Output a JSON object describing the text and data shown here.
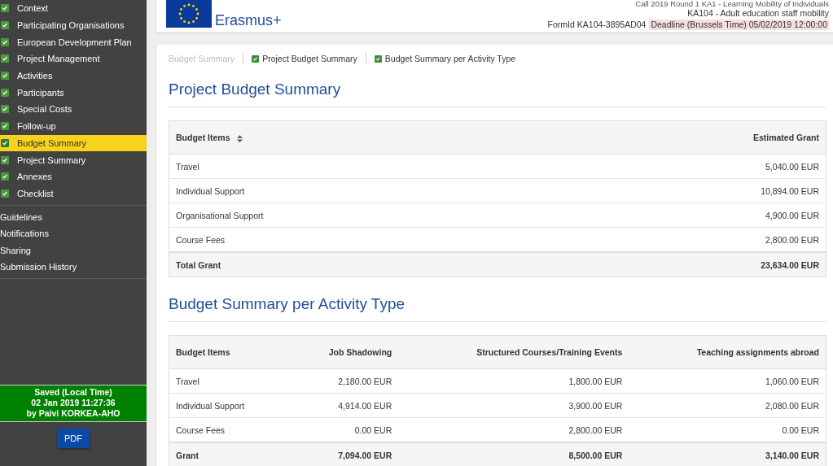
{
  "sidebar": {
    "items": [
      {
        "label": "Context",
        "checked": true,
        "selected": false
      },
      {
        "label": "Participating Organisations",
        "checked": true,
        "selected": false
      },
      {
        "label": "European Development Plan",
        "checked": true,
        "selected": false
      },
      {
        "label": "Project Management",
        "checked": true,
        "selected": false
      },
      {
        "label": "Activities",
        "checked": true,
        "selected": false
      },
      {
        "label": "Participants",
        "checked": true,
        "selected": false
      },
      {
        "label": "Special Costs",
        "checked": true,
        "selected": false
      },
      {
        "label": "Follow-up",
        "checked": true,
        "selected": false
      },
      {
        "label": "Budget Summary",
        "checked": true,
        "selected": true
      },
      {
        "label": "Project Summary",
        "checked": true,
        "selected": false
      },
      {
        "label": "Annexes",
        "checked": true,
        "selected": false
      },
      {
        "label": "Checklist",
        "checked": true,
        "selected": false
      }
    ],
    "links": [
      "Guidelines",
      "Notifications",
      "Sharing",
      "Submission History"
    ],
    "saved": [
      "Saved (Local Time)",
      "02 Jan 2019 11:27:36",
      "by Paivi KORKEA-AHO"
    ],
    "pdf_button": "PDF"
  },
  "header": {
    "logo_text": "Erasmus+",
    "call": "Call 2019 Round 1 KA1 - Learning Mobility of Individuals",
    "action": "KA104 - Adult education staff mobility",
    "form_id": "FormId KA104-3895AD04",
    "deadline": "Deadline (Brussels Time) 05/02/2019 12:00:00"
  },
  "subnav": [
    {
      "label": "Budget Summary",
      "checked": false
    },
    {
      "label": "Project Budget Summary",
      "checked": true
    },
    {
      "label": "Budget Summary per Activity Type",
      "checked": true
    }
  ],
  "project_budget": {
    "title": "Project Budget Summary",
    "columns": [
      "Budget Items",
      "Estimated Grant"
    ],
    "rows": [
      [
        "Travel",
        "5,040.00 EUR"
      ],
      [
        "Individual Support",
        "10,894.00 EUR"
      ],
      [
        "Organisational Support",
        "4,900.00 EUR"
      ],
      [
        "Course Fees",
        "2,800.00 EUR"
      ]
    ],
    "total": [
      "Total Grant",
      "23,634.00 EUR"
    ]
  },
  "activity_budget": {
    "title": "Budget Summary per Activity Type",
    "columns": [
      "Budget Items",
      "Job Shadowing",
      "Structured Courses/Training Events",
      "Teaching assignments abroad"
    ],
    "rows": [
      [
        "Travel",
        "2,180.00 EUR",
        "1,800.00 EUR",
        "1,060.00 EUR"
      ],
      [
        "Individual Support",
        "4,914.00 EUR",
        "3,900.00 EUR",
        "2,080.00 EUR"
      ],
      [
        "Course Fees",
        "0.00 EUR",
        "2,800.00 EUR",
        "0.00 EUR"
      ]
    ],
    "total": [
      "Grant",
      "7,094.00 EUR",
      "8,500.00 EUR",
      "3,140.00 EUR"
    ]
  }
}
